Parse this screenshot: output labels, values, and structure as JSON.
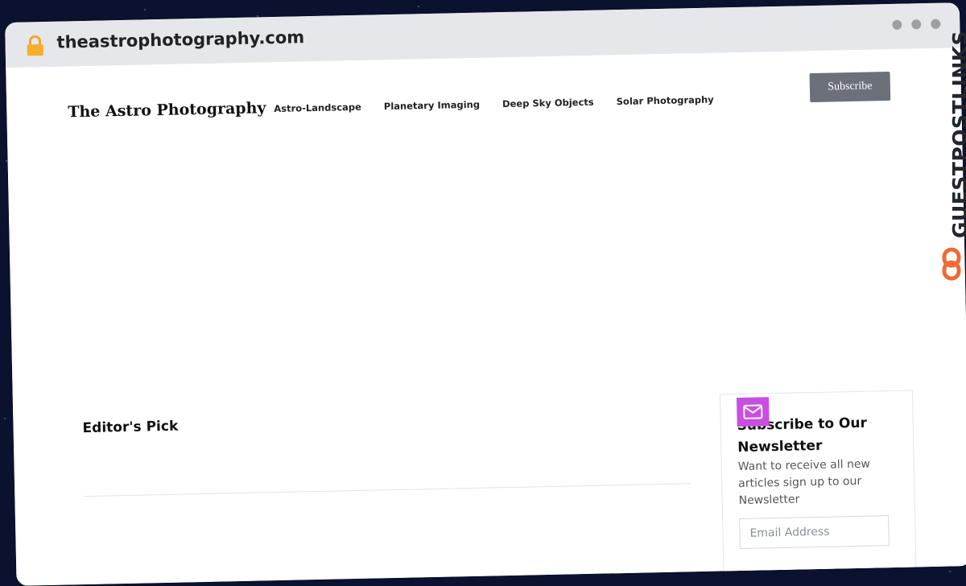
{
  "browser": {
    "url": "theastrophotography.com",
    "lock_icon": "lock-icon",
    "window_controls": [
      "dot",
      "dot",
      "dot"
    ]
  },
  "site": {
    "logo": "The Astro Photography",
    "nav": [
      "Astro-Landscape",
      "Planetary Imaging",
      "Deep Sky Objects",
      "Solar Photography"
    ],
    "subscribe_label": "Subscribe"
  },
  "main": {
    "editors_pick": "Editor's Pick"
  },
  "newsletter": {
    "icon": "mail-icon",
    "title": "Subscribe to Our Newsletter",
    "text": "Want to receive all new articles sign up to our Newsletter",
    "email_placeholder": "Email Address"
  },
  "watermark": {
    "text": "GUESTPOSTLINKS",
    "icon": "link-icon"
  },
  "colors": {
    "accent_purple": "#c94fe0",
    "button_gray": "#6b7079",
    "watermark_orange": "#f06a35",
    "background_space": "#0b1230"
  }
}
